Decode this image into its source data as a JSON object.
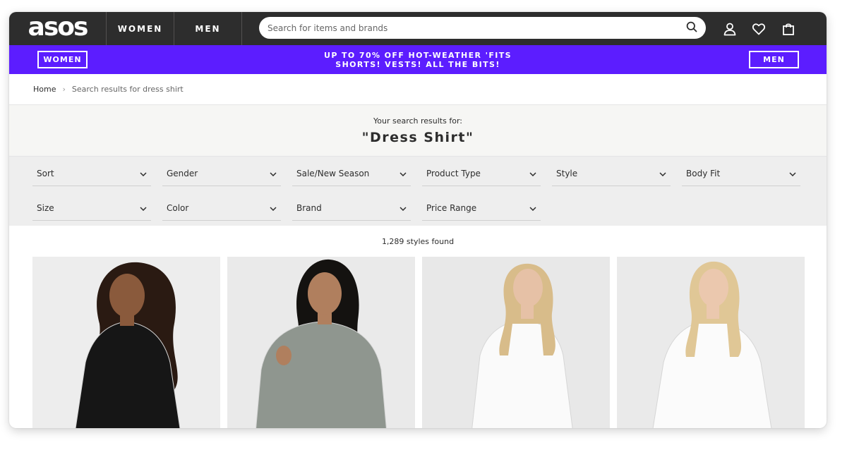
{
  "header": {
    "logo_text": "asos",
    "nav_women": "WOMEN",
    "nav_men": "MEN",
    "search_placeholder": "Search for items and brands"
  },
  "promo": {
    "left_button": "WOMEN",
    "right_button": "MEN",
    "line1": "UP TO 70% OFF HOT-WEATHER 'FITS",
    "line2": "SHORTS! VESTS! ALL THE BITS!",
    "background_color": "#5c1dff"
  },
  "breadcrumb": {
    "home": "Home",
    "separator": "›",
    "current": "Search results for dress shirt"
  },
  "search_heading": {
    "label": "Your search results for:",
    "term": "\"Dress Shirt\""
  },
  "filters": [
    {
      "label": "Sort"
    },
    {
      "label": "Gender"
    },
    {
      "label": "Sale/New Season"
    },
    {
      "label": "Product Type"
    },
    {
      "label": "Style"
    },
    {
      "label": "Body Fit"
    },
    {
      "label": "Size"
    },
    {
      "label": "Color"
    },
    {
      "label": "Brand"
    },
    {
      "label": "Price Range"
    }
  ],
  "results_count": "1,289 styles found",
  "products": [
    {
      "dress_color": "#161616",
      "hair_color": "#2a1a12",
      "skin_color": "#8a5a3c",
      "bg": "#ededed"
    },
    {
      "dress_color": "#8f968f",
      "hair_color": "#141210",
      "skin_color": "#b07f5e",
      "bg": "#eaeaea"
    },
    {
      "dress_color": "#fafafa",
      "hair_color": "#d8bc8a",
      "skin_color": "#e6c1a6",
      "bg": "#e8e8e8"
    },
    {
      "dress_color": "#fbfbfb",
      "hair_color": "#e0c796",
      "skin_color": "#ebc8ae",
      "bg": "#eaeaea"
    }
  ]
}
